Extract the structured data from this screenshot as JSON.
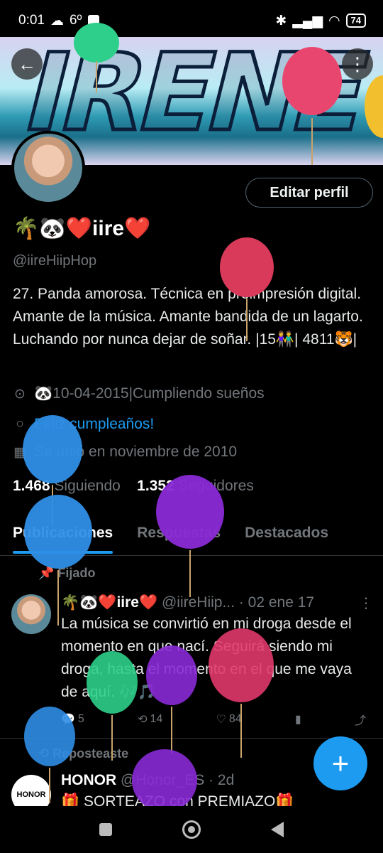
{
  "status": {
    "time": "0:01",
    "temp": "6º",
    "battery": "74"
  },
  "banner": {
    "text": "IRENE"
  },
  "profile": {
    "edit_label": "Editar perfil",
    "name": "🌴🐼❤️iire❤️",
    "handle": "@iireHiipHop",
    "bio": "27. Panda amorosa. Técnica en preimpresión digital. Amante de la música. Amante bandida de un lagarto. Luchando por nunca dejar de soñar. |15👫| 4811🐯|",
    "location": "🐼10-04-2015|Cumpliendo sueños",
    "birthday": "Feliz cumpleaños!",
    "joined": "Se unió en noviembre de 2010",
    "following_count": "1.468",
    "following_label": "Siguiendo",
    "followers_count": "1.352",
    "followers_label": "Seguidores"
  },
  "tabs": [
    "Publicaciones",
    "Respuestas",
    "Destacados"
  ],
  "pinned": {
    "label": "Fijado",
    "name": "🌴🐼❤️iire❤️",
    "handle": "@iireHiip...",
    "date": "· 02 ene 17",
    "text": "La música se convirtió en mi droga desde el momento en que nací. Seguirá siendo mi droga, hasta el momento en el que me vaya de aquí. 🎶🎵",
    "replies": "5",
    "reposts": "14",
    "likes": "84"
  },
  "repost": {
    "label": "Reposteaste",
    "name": "HONOR",
    "handle": "@Honor_ES · 2d",
    "logo": "HONOR",
    "text": "🎁 SORTEAZO con PREMIAZO🎁"
  },
  "fab_label": "+",
  "colors": {
    "accent": "#1d9bf0",
    "background": "#000000",
    "muted": "#71767b"
  }
}
